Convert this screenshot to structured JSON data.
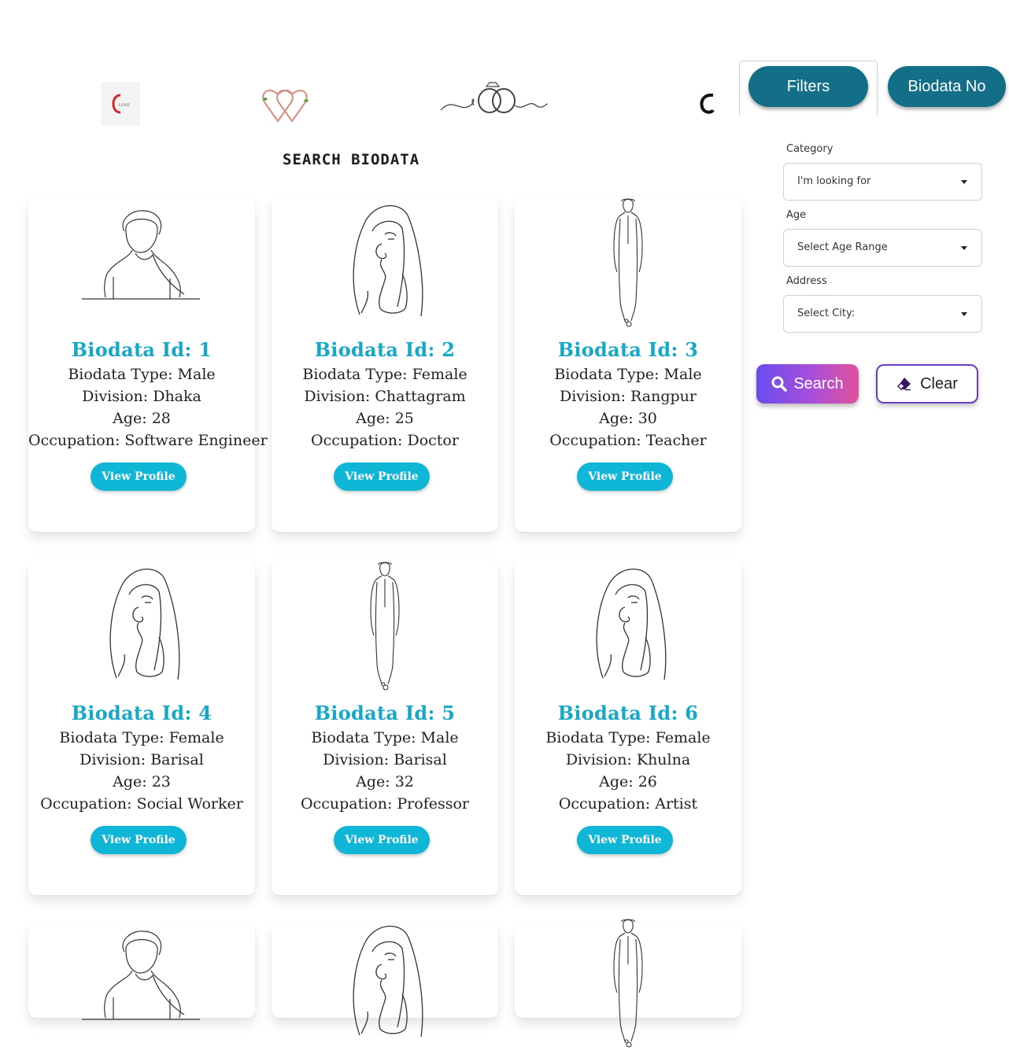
{
  "header": {
    "logos": [
      "love-badge",
      "hearts-logo",
      "rings-logo",
      "partial-logo"
    ],
    "logo_text": "LOVE",
    "title": "SEARCH BIODATA"
  },
  "filters_panel": {
    "tabs": [
      {
        "label": "Filters"
      },
      {
        "label": "Biodata No"
      }
    ],
    "category": {
      "label": "Category",
      "value": "I'm looking for"
    },
    "age": {
      "label": "Age",
      "value": "Select Age Range"
    },
    "address": {
      "label": "Address",
      "value": "Select City:"
    },
    "search_label": "Search",
    "clear_label": "Clear",
    "colors": {
      "tab": "#136f87",
      "search_gradient_start": "#6a4cf0",
      "search_gradient_end": "#e1529a",
      "clear_border": "#6a3ec3"
    }
  },
  "cards": [
    {
      "id_text": "Biodata Id: 1",
      "type": "Biodata Type: Male",
      "division": "Division: Dhaka",
      "age": "Age: 28",
      "occupation": "Occupation: Software Engineer",
      "button": "View Profile",
      "figure": "man-bust"
    },
    {
      "id_text": "Biodata Id: 2",
      "type": "Biodata Type: Female",
      "division": "Division: Chattagram",
      "age": "Age: 25",
      "occupation": "Occupation: Doctor",
      "button": "View Profile",
      "figure": "woman-hijab"
    },
    {
      "id_text": "Biodata Id: 3",
      "type": "Biodata Type: Male",
      "division": "Division: Rangpur",
      "age": "Age: 30",
      "occupation": "Occupation: Teacher",
      "button": "View Profile",
      "figure": "man-full"
    },
    {
      "id_text": "Biodata Id: 4",
      "type": "Biodata Type: Female",
      "division": "Division: Barisal",
      "age": "Age: 23",
      "occupation": "Occupation: Social Worker",
      "button": "View Profile",
      "figure": "woman-hijab"
    },
    {
      "id_text": "Biodata Id: 5",
      "type": "Biodata Type: Male",
      "division": "Division: Barisal",
      "age": "Age: 32",
      "occupation": "Occupation: Professor",
      "button": "View Profile",
      "figure": "man-full"
    },
    {
      "id_text": "Biodata Id: 6",
      "type": "Biodata Type: Female",
      "division": "Division: Khulna",
      "age": "Age: 26",
      "occupation": "Occupation: Artist",
      "button": "View Profile",
      "figure": "woman-hijab"
    }
  ],
  "partial_cards": [
    {
      "figure": "man-bust"
    },
    {
      "figure": "woman-hijab"
    },
    {
      "figure": "man-full"
    }
  ],
  "accent_color": "#16a8c6",
  "button_color": "#10b6d6"
}
